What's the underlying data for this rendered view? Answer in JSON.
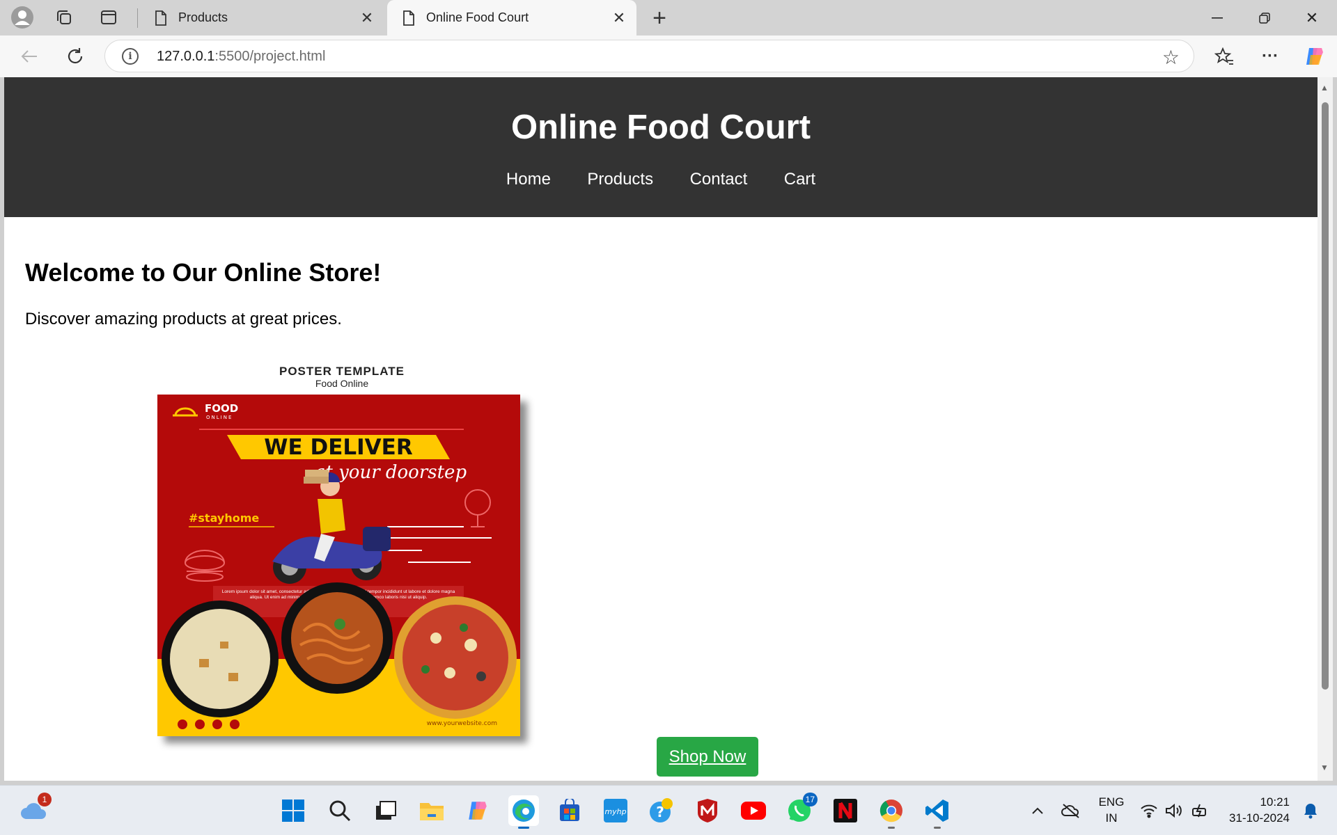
{
  "browser": {
    "tabs": [
      {
        "title": "Products",
        "active": false
      },
      {
        "title": "Online Food Court",
        "active": true
      }
    ],
    "address": {
      "host": "127.0.0.1",
      "rest": ":5500/project.html"
    }
  },
  "page": {
    "title": "Online Food Court",
    "nav": [
      "Home",
      "Products",
      "Contact",
      "Cart"
    ],
    "welcome": "Welcome to Our Online Store!",
    "tagline": "Discover amazing products at great prices.",
    "poster": {
      "caption_title": "POSTER TEMPLATE",
      "caption_sub": "Food Online",
      "brand_line1": "FOOD",
      "brand_line2": "ONLINE",
      "headline": "WE DELIVER",
      "subheadline": "at your doorstep",
      "hashtag": "#stayhome",
      "body_text": "Lorem ipsum dolor sit amet, consectetur adipisicing elit, sed do eiusmod tempor incididunt ut labore et dolore magna aliqua. Ut enim ad minim veniam, quis nostrud exercitation ullamco laboris nisi ut aliquip.",
      "website": "www.yourwebsite.com"
    },
    "cta": "Shop Now",
    "colors": {
      "header": "#333333",
      "cta": "#28a745",
      "poster_red": "#b40a0a",
      "poster_yellow": "#ffc800"
    }
  },
  "taskbar": {
    "weather_badge": "1",
    "whatsapp_badge": "17",
    "lang_line1": "ENG",
    "lang_line2": "IN",
    "time": "10:21",
    "date": "31-10-2024"
  }
}
